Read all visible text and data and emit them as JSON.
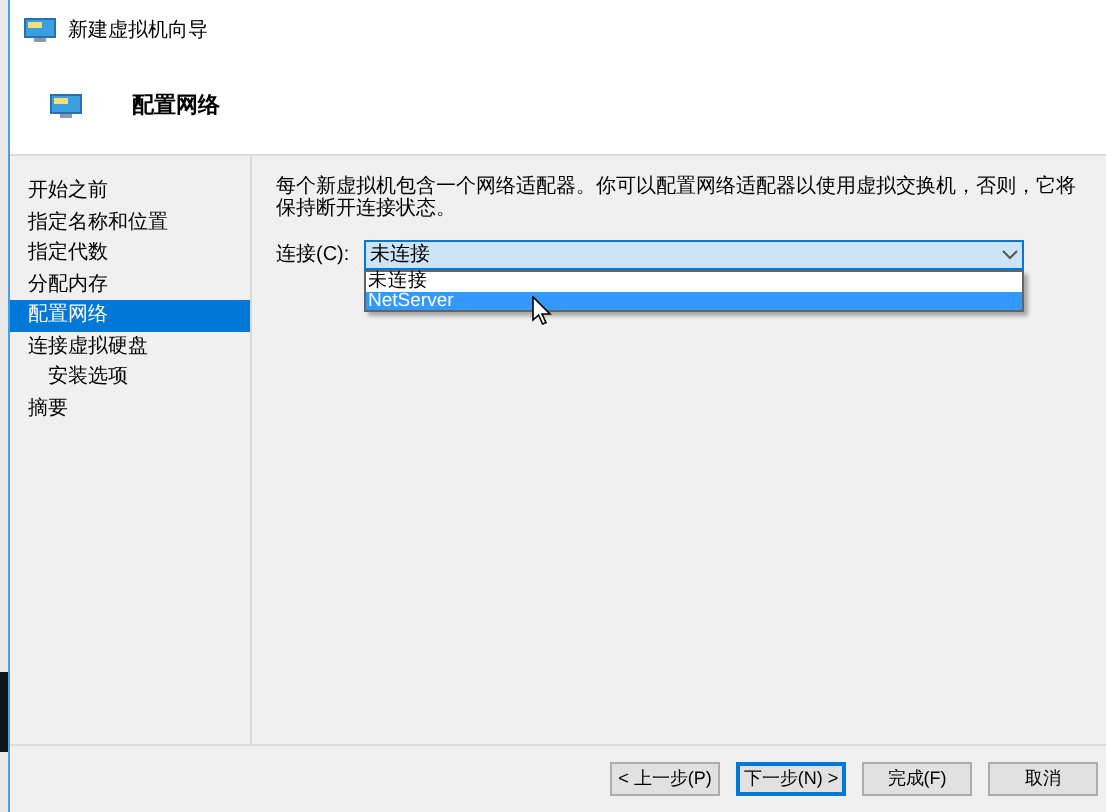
{
  "window": {
    "title": "新建虚拟机向导"
  },
  "header": {
    "title": "配置网络"
  },
  "sidebar": {
    "items": [
      {
        "label": "开始之前",
        "selected": false
      },
      {
        "label": "指定名称和位置",
        "selected": false
      },
      {
        "label": "指定代数",
        "selected": false
      },
      {
        "label": "分配内存",
        "selected": false
      },
      {
        "label": "配置网络",
        "selected": true
      },
      {
        "label": "连接虚拟硬盘",
        "selected": false,
        "children": [
          {
            "label": "安装选项",
            "selected": false
          }
        ]
      },
      {
        "label": "摘要",
        "selected": false
      }
    ]
  },
  "content": {
    "description": "每个新虚拟机包含一个网络适配器。你可以配置网络适配器以使用虚拟交换机，否则，它将保持断开连接状态。",
    "connection": {
      "label": "连接(C):",
      "value": "未连接",
      "expanded": true,
      "options": [
        {
          "label": "未连接",
          "highlighted": false
        },
        {
          "label": "NetServer",
          "highlighted": true
        }
      ]
    }
  },
  "buttons": [
    {
      "label": "< 上一步(P)",
      "default": false
    },
    {
      "label": "下一步(N) >",
      "default": true
    },
    {
      "label": "完成(F)",
      "default": false
    },
    {
      "label": "取消",
      "default": false
    }
  ]
}
